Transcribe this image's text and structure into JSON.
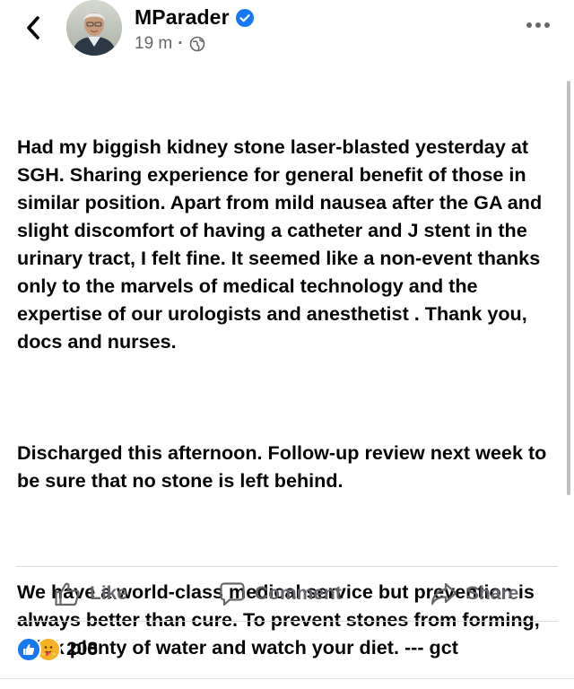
{
  "header": {
    "author": "MParader",
    "time": "19 m",
    "audience_icon": "globe-icon",
    "verified_icon": "verified-badge-icon",
    "back_icon": "chevron-left-icon",
    "more_icon": "more-icon"
  },
  "post": {
    "paragraphs": [
      "Had my biggish kidney stone laser-blasted yesterday at SGH. Sharing experience for general benefit of those in similar position. Apart from mild nausea after the GA and slight discomfort of having a catheter and J stent in the urinary tract, I felt fine. It seemed like a non-event thanks only to the marvels of medical technology and the expertise of our urologists and anesthetist . Thank you, docs and nurses.",
      "Discharged this afternoon. Follow-up review next week to be sure that no stone is left behind.",
      "We have a world-class medical service but prevention is always better than cure. To prevent stones from forming, drink plenty of water and watch your diet. --- gct"
    ]
  },
  "actions": {
    "like_label": "Like",
    "comment_label": "Comment",
    "share_label": "Share"
  },
  "reactions": {
    "count": "208",
    "icons": [
      "like-reaction-icon",
      "care-reaction-icon"
    ]
  },
  "colors": {
    "text": "#050505",
    "secondary": "#65676b",
    "accent": "#1877f2",
    "care": "#f7b125",
    "divider": "#dadde1"
  }
}
